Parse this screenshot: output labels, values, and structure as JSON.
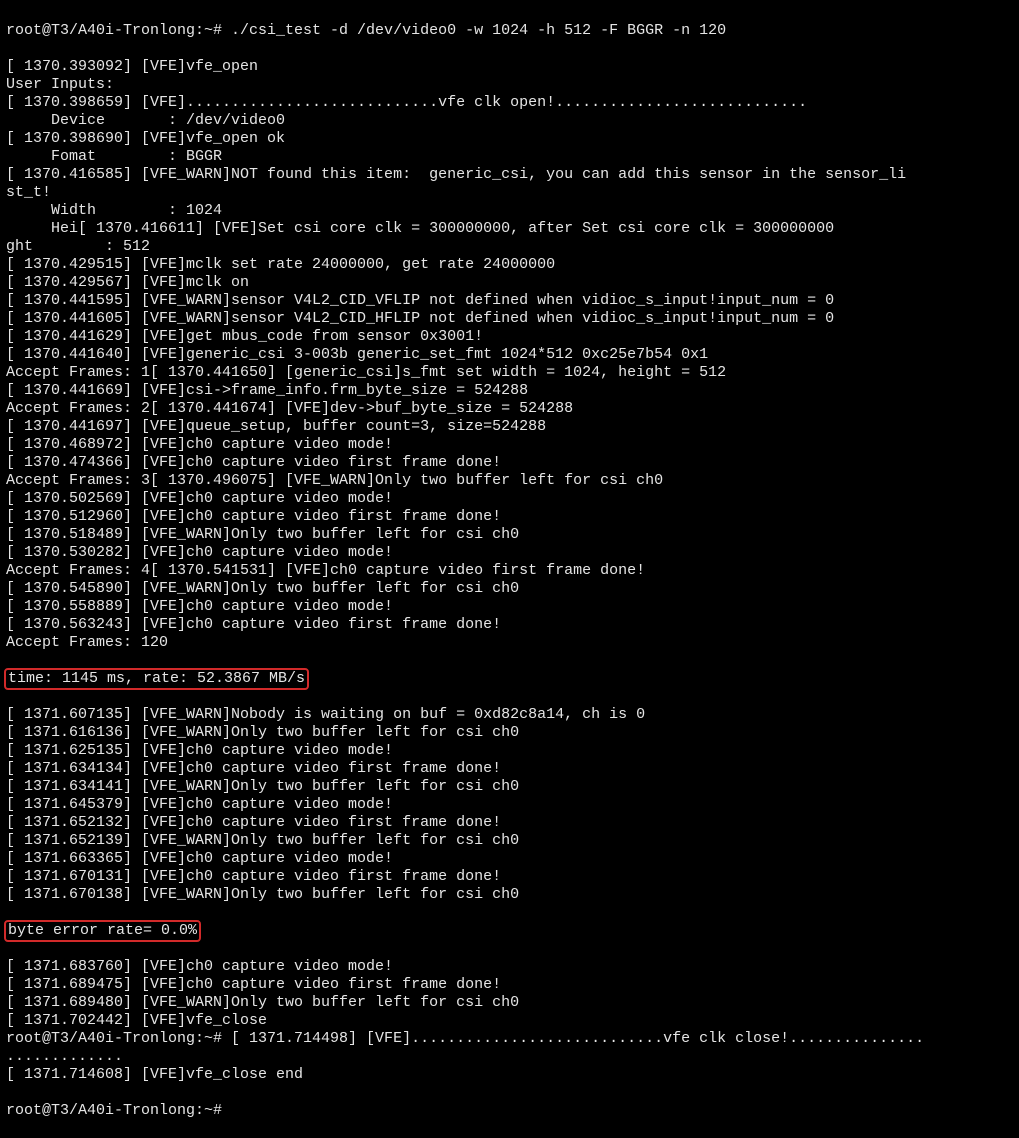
{
  "prompt1": "root@T3/A40i-Tronlong:~# ./csi_test -d /dev/video0 -w 1024 -h 512 -F BGGR -n 120",
  "lines_a": [
    "[ 1370.393092] [VFE]vfe_open",
    "User Inputs:",
    "[ 1370.398659] [VFE]............................vfe clk open!............................",
    "     Device       : /dev/video0",
    "[ 1370.398690] [VFE]vfe_open ok",
    "     Fomat        : BGGR",
    "[ 1370.416585] [VFE_WARN]NOT found this item:  generic_csi, you can add this sensor in the sensor_li",
    "st_t!",
    "     Width        : 1024",
    "     Hei[ 1370.416611] [VFE]Set csi core clk = 300000000, after Set csi core clk = 300000000",
    "ght        : 512",
    "",
    "[ 1370.429515] [VFE]mclk set rate 24000000, get rate 24000000",
    "[ 1370.429567] [VFE]mclk on",
    "[ 1370.441595] [VFE_WARN]sensor V4L2_CID_VFLIP not defined when vidioc_s_input!input_num = 0",
    "[ 1370.441605] [VFE_WARN]sensor V4L2_CID_HFLIP not defined when vidioc_s_input!input_num = 0",
    "[ 1370.441629] [VFE]get mbus_code from sensor 0x3001!",
    "[ 1370.441640] [VFE]generic_csi 3-003b generic_set_fmt 1024*512 0xc25e7b54 0x1",
    "Accept Frames: 1[ 1370.441650] [generic_csi]s_fmt set width = 1024, height = 512",
    "[ 1370.441669] [VFE]csi->frame_info.frm_byte_size = 524288",
    "Accept Frames: 2[ 1370.441674] [VFE]dev->buf_byte_size = 524288",
    "[ 1370.441697] [VFE]queue_setup, buffer count=3, size=524288",
    "[ 1370.468972] [VFE]ch0 capture video mode!",
    "[ 1370.474366] [VFE]ch0 capture video first frame done!",
    "Accept Frames: 3[ 1370.496075] [VFE_WARN]Only two buffer left for csi ch0",
    "[ 1370.502569] [VFE]ch0 capture video mode!",
    "[ 1370.512960] [VFE]ch0 capture video first frame done!",
    "[ 1370.518489] [VFE_WARN]Only two buffer left for csi ch0",
    "[ 1370.530282] [VFE]ch0 capture video mode!",
    "Accept Frames: 4[ 1370.541531] [VFE]ch0 capture video first frame done!",
    "[ 1370.545890] [VFE_WARN]Only two buffer left for csi ch0",
    "[ 1370.558889] [VFE]ch0 capture video mode!",
    "[ 1370.563243] [VFE]ch0 capture video first frame done!",
    "Accept Frames: 120"
  ],
  "highlight1": "time: 1145 ms, rate: 52.3867 MB/s",
  "lines_b": [
    "[ 1371.607135] [VFE_WARN]Nobody is waiting on buf = 0xd82c8a14, ch is 0",
    "[ 1371.616136] [VFE_WARN]Only two buffer left for csi ch0",
    "[ 1371.625135] [VFE]ch0 capture video mode!",
    "[ 1371.634134] [VFE]ch0 capture video first frame done!",
    "[ 1371.634141] [VFE_WARN]Only two buffer left for csi ch0",
    "[ 1371.645379] [VFE]ch0 capture video mode!",
    "[ 1371.652132] [VFE]ch0 capture video first frame done!",
    "[ 1371.652139] [VFE_WARN]Only two buffer left for csi ch0",
    "[ 1371.663365] [VFE]ch0 capture video mode!",
    "[ 1371.670131] [VFE]ch0 capture video first frame done!",
    "[ 1371.670138] [VFE_WARN]Only two buffer left for csi ch0"
  ],
  "highlight2": "byte error rate= 0.0%",
  "lines_c": [
    "[ 1371.683760] [VFE]ch0 capture video mode!",
    "[ 1371.689475] [VFE]ch0 capture video first frame done!",
    "[ 1371.689480] [VFE_WARN]Only two buffer left for csi ch0",
    "[ 1371.702442] [VFE]vfe_close",
    "root@T3/A40i-Tronlong:~# [ 1371.714498] [VFE]............................vfe clk close!...............",
    ".............",
    "[ 1371.714608] [VFE]vfe_close end",
    ""
  ],
  "prompt2": "root@T3/A40i-Tronlong:~#"
}
